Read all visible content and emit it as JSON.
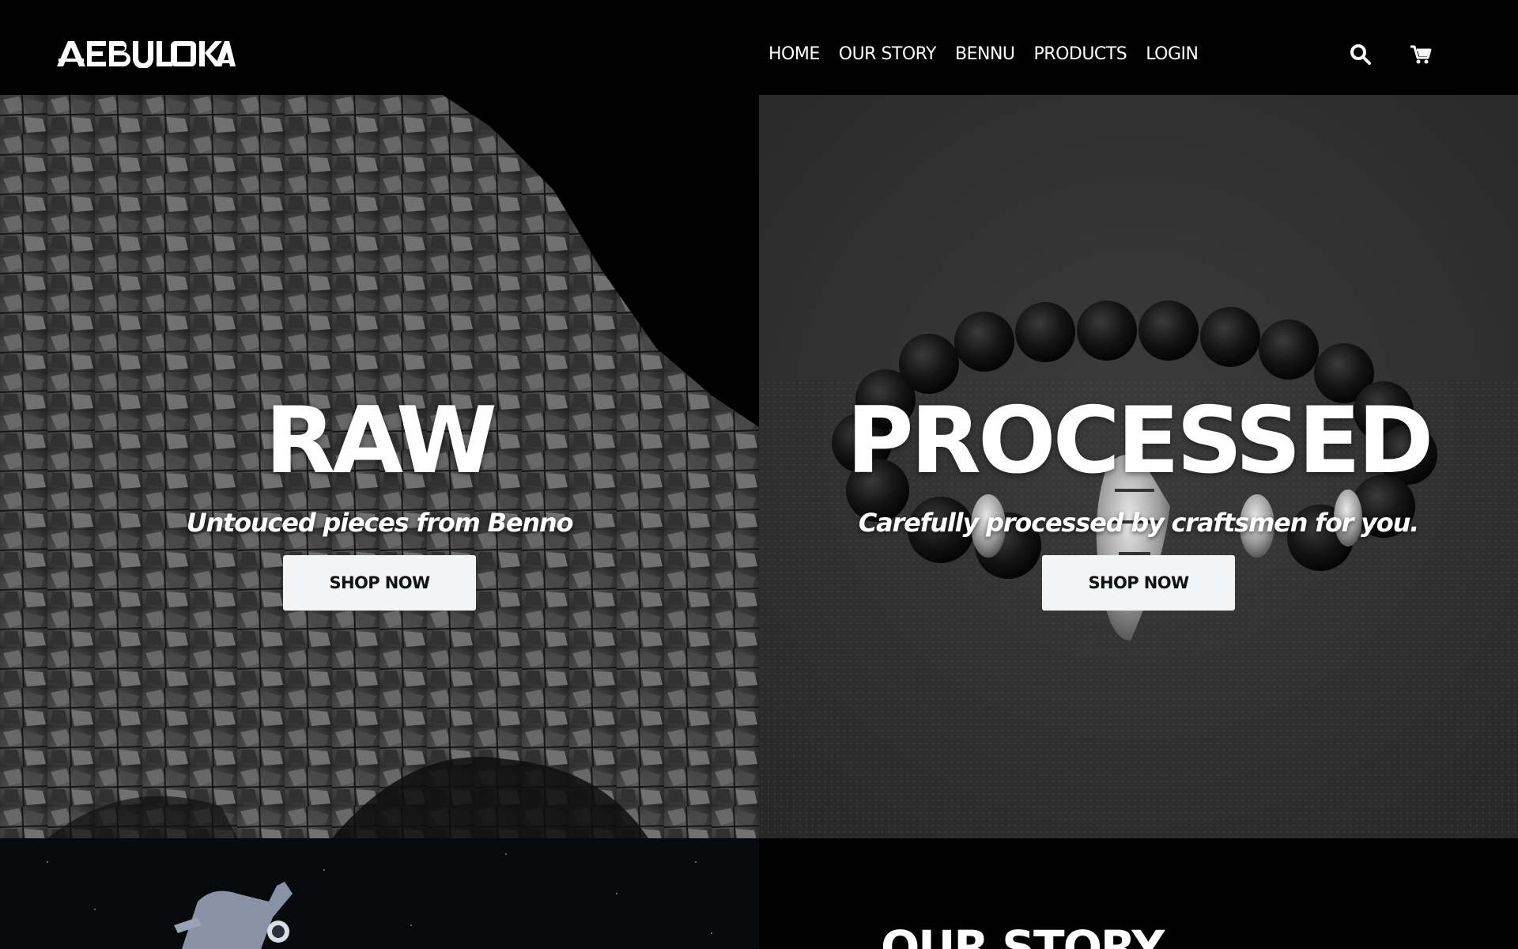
{
  "header": {
    "logo_text": "AEBULOKA",
    "nav": [
      "HOME",
      "OUR STORY",
      "BENNU",
      "PRODUCTS",
      "LOGIN"
    ],
    "icons": [
      "search-icon",
      "cart-icon"
    ]
  },
  "hero": {
    "left": {
      "title": "RAW",
      "subtitle": "Untouced pieces from Benno",
      "button": "SHOP NOW"
    },
    "right": {
      "title": "PROCESSED",
      "subtitle": "Carefully processed by craftsmen for you.",
      "button": "SHOP NOW"
    }
  },
  "story": {
    "title": "OUR STORY"
  },
  "colors": {
    "background": "#000000",
    "button_bg": "#f3f4f6",
    "button_text": "#111111",
    "text": "#ffffff"
  }
}
